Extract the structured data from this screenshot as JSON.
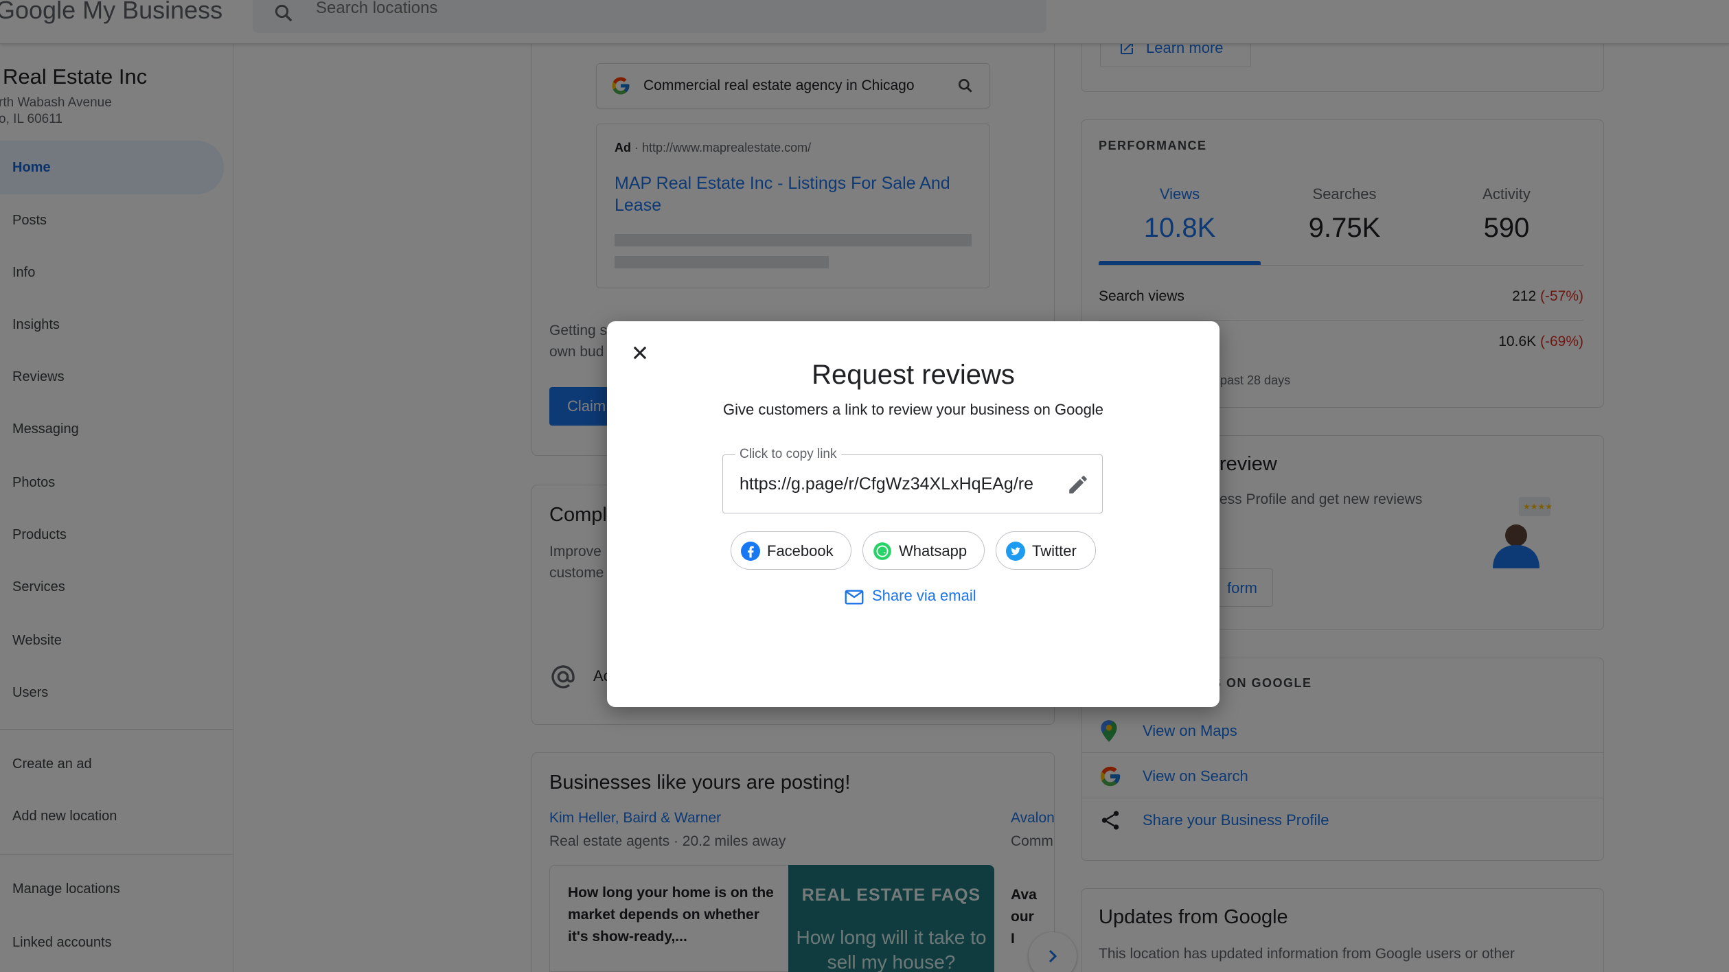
{
  "app": {
    "brand": "Google My Business",
    "search_placeholder": "Search locations"
  },
  "sidebar": {
    "business_name": "Real Estate Inc",
    "address_line1": "rth Wabash Avenue",
    "address_line2": "o, IL 60611",
    "nav": [
      "Home",
      "Posts",
      "Info",
      "Insights",
      "Reviews",
      "Messaging",
      "Photos",
      "Products",
      "Services",
      "Website",
      "Users"
    ],
    "secondary": [
      "Create an ad",
      "Add new location"
    ],
    "tertiary": [
      "Manage locations",
      "Linked accounts"
    ]
  },
  "main": {
    "ad_preview": {
      "query": "Commercial real estate agency in Chicago",
      "ad_label": "Ad",
      "ad_url": "http://www.maprealestate.com/",
      "ad_title": "MAP Real Estate Inc - Listings For Sale And Lease"
    },
    "claim_text_1": "Getting s",
    "claim_text_2": "own bud",
    "claim_button": "Claim",
    "complete_title": "Compl",
    "complete_text_1": "Improve",
    "complete_text_2": "custome",
    "complete_row_label": "Ac",
    "posting": {
      "title": "Businesses like yours are posting!",
      "biz1_name": "Kim Heller, Baird & Warner",
      "biz1_meta": "Real estate agents · 20.2 miles away",
      "biz2_name": "Avalon",
      "biz2_meta": "Comm",
      "post_text": "How long your home is on the market depends on whether it's show-ready,...",
      "post_img_head": "REAL ESTATE FAQS",
      "post_img_body": "How long will it take to sell my house?",
      "post2_text_1": "Ava",
      "post2_text_2": "our",
      "post2_text_3": "I"
    }
  },
  "right": {
    "learn_more": "Learn more",
    "performance": {
      "label": "PERFORMANCE",
      "tabs": [
        {
          "title": "Views",
          "value": "10.8K"
        },
        {
          "title": "Searches",
          "value": "9.75K"
        },
        {
          "title": "Activity",
          "value": "590"
        }
      ],
      "rows": [
        {
          "label": "Search views",
          "value": "212",
          "change": "(-57%)"
        },
        {
          "label": "",
          "value": "10.6K",
          "change": "(-69%)"
        }
      ],
      "footnote": "e past 28 days"
    },
    "review_card": {
      "title": "review",
      "desc": "ess Profile and get new reviews",
      "button": "form"
    },
    "google_card": {
      "label": "S ON GOOGLE",
      "links": [
        "View on Maps",
        "View on Search",
        "Share your Business Profile"
      ]
    },
    "updates": {
      "title": "Updates from Google",
      "body": "This location has updated information from Google users or other"
    }
  },
  "dialog": {
    "title": "Request reviews",
    "subtitle": "Give customers a link to review your business on Google",
    "field_label": "Click to copy link",
    "link_value": "https://g.page/r/CfgWz34XLxHqEAg/re",
    "share": [
      "Facebook",
      "Whatsapp",
      "Twitter"
    ],
    "email": "Share via email"
  },
  "colors": {
    "accent": "#1a73e8",
    "negative": "#d93025",
    "scrim": "rgba(0,0,0,0.5)",
    "facebook": "#1877f2",
    "whatsapp": "#25d366",
    "twitter": "#1d9bf0"
  }
}
